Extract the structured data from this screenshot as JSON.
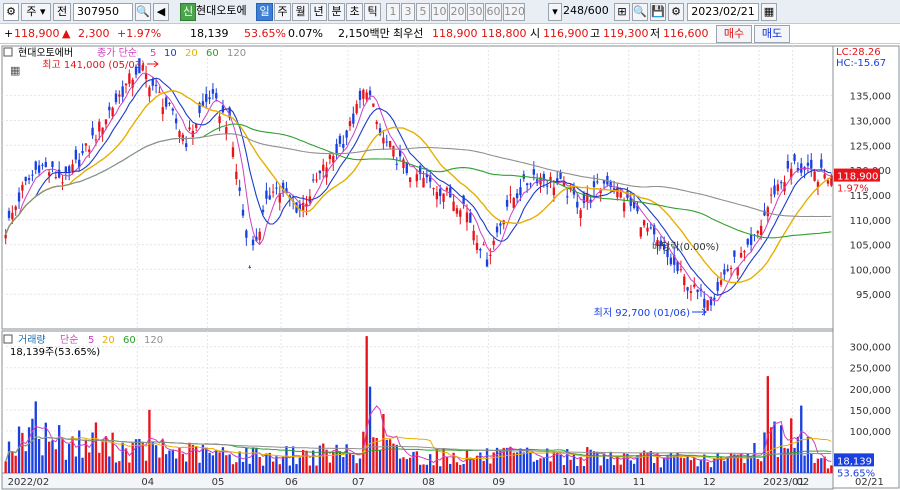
{
  "toolbar": {
    "market_sel": "주",
    "type_sel": "전",
    "code": "307950",
    "stock_tag": "신",
    "stock_name": "현대오토에",
    "periods": [
      "일",
      "주",
      "월",
      "년",
      "분",
      "초",
      "틱"
    ],
    "active_period": "일",
    "intervals": [
      "1",
      "3",
      "5",
      "10",
      "20",
      "30",
      "60",
      "120"
    ],
    "count": "248/600",
    "date": "2023/02/21"
  },
  "quote": {
    "price": "118,900",
    "change": "2,300",
    "change_pct": "+1.97%",
    "volume": "18,139",
    "volume_ratio": "53.65%",
    "turnover": "0.07%",
    "amount": "2,150백만",
    "ask_label": "최우선",
    "ask": "118,900",
    "bid": "118,800",
    "open_label": "시",
    "open": "116,900",
    "high_label": "고",
    "high": "119,300",
    "low_label": "저",
    "low": "116,600",
    "buy_btn": "매수",
    "sell_btn": "매도"
  },
  "price_legend": {
    "name": "현대오토에버",
    "ma_label": "종가 단순",
    "periods": [
      "5",
      "10",
      "20",
      "60",
      "120"
    ]
  },
  "volume_legend": {
    "name": "거래량",
    "ma_label": "단순",
    "periods": [
      "5",
      "20",
      "60",
      "120"
    ],
    "value": "18,139주(53.65%)"
  },
  "annotations": {
    "high": "최고 141,000 (05/03)",
    "low": "최저 92,700 (01/06)",
    "dividend": "배당락(0.00%)",
    "lc": "LC:28.26",
    "hc": "HC:-15.67"
  },
  "last_labels": {
    "price": "118,900",
    "pct": "1.97%",
    "volume": "18,139",
    "volume_pct": "53.65%"
  },
  "colors": {
    "up": "#e8141c",
    "down": "#1a40e0",
    "ma5": "#d040c0",
    "ma10": "#1c3cc8",
    "ma20": "#e6b000",
    "ma60": "#30a030",
    "ma120": "#909090"
  },
  "chart_data": {
    "type": "candlestick",
    "price_axis": [
      "135,000",
      "130,000",
      "125,000",
      "120,000",
      "115,000",
      "110,000",
      "105,000",
      "100,000",
      "95,000"
    ],
    "volume_axis": [
      "300,000",
      "250,000",
      "200,000",
      "150,000",
      "100,000"
    ],
    "x_labels": [
      "2022/02",
      "04",
      "05",
      "06",
      "07",
      "08",
      "09",
      "10",
      "11",
      "12",
      "2023/01",
      "02",
      "02/21"
    ],
    "ylim": [
      88000,
      145000
    ],
    "volume_ylim": [
      0,
      330000
    ],
    "price_keys": [
      [
        0,
        108000
      ],
      [
        5,
        116000
      ],
      [
        10,
        121000
      ],
      [
        18,
        118000
      ],
      [
        25,
        125000
      ],
      [
        32,
        133000
      ],
      [
        40,
        141000
      ],
      [
        48,
        133000
      ],
      [
        54,
        126000
      ],
      [
        61,
        135000
      ],
      [
        67,
        129000
      ],
      [
        73,
        102000
      ],
      [
        80,
        117000
      ],
      [
        88,
        112000
      ],
      [
        95,
        120000
      ],
      [
        102,
        127000
      ],
      [
        108,
        137000
      ],
      [
        112,
        127000
      ],
      [
        120,
        120000
      ],
      [
        128,
        117000
      ],
      [
        137,
        113000
      ],
      [
        144,
        102000
      ],
      [
        150,
        113000
      ],
      [
        158,
        119000
      ],
      [
        166,
        117000
      ],
      [
        172,
        113000
      ],
      [
        180,
        118000
      ],
      [
        188,
        112000
      ],
      [
        196,
        104000
      ],
      [
        204,
        97000
      ],
      [
        210,
        93000
      ],
      [
        216,
        100000
      ],
      [
        223,
        104000
      ],
      [
        230,
        116000
      ],
      [
        236,
        121000
      ],
      [
        241,
        119000
      ],
      [
        247,
        118900
      ]
    ],
    "volume_keys": [
      [
        0,
        60000
      ],
      [
        10,
        90000
      ],
      [
        20,
        70000
      ],
      [
        40,
        55000
      ],
      [
        60,
        45000
      ],
      [
        80,
        40000
      ],
      [
        100,
        45000
      ],
      [
        110,
        70000
      ],
      [
        120,
        40000
      ],
      [
        140,
        38000
      ],
      [
        160,
        40000
      ],
      [
        180,
        38000
      ],
      [
        200,
        32000
      ],
      [
        215,
        30000
      ],
      [
        225,
        55000
      ],
      [
        232,
        100000
      ],
      [
        240,
        55000
      ],
      [
        247,
        18139
      ]
    ],
    "volume_spikes": [
      [
        9,
        170000
      ],
      [
        27,
        120000
      ],
      [
        43,
        150000
      ],
      [
        108,
        325000
      ],
      [
        109,
        205000
      ],
      [
        113,
        140000
      ],
      [
        228,
        230000
      ],
      [
        238,
        160000
      ]
    ]
  }
}
